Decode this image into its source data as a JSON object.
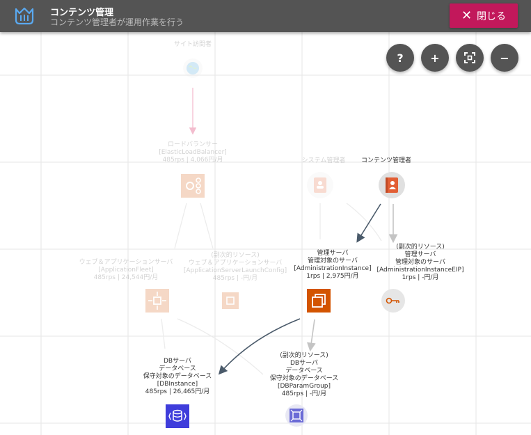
{
  "header": {
    "title": "コンテンツ管理",
    "subtitle": "コンテンツ管理者が運用作業を行う",
    "close_label": "閉じる",
    "logo_icon": "crown-basket-icon"
  },
  "controls": {
    "help": "?",
    "zoom_in": "+",
    "zoom_out": "−"
  },
  "colors": {
    "header_bg": "#545454",
    "close_button": "#c2185b",
    "admin_server": "#d35400",
    "db_server": "#3f3ddb",
    "content_admin": "#e25e34",
    "edge_dark": "#4a5a6a",
    "edge_light": "#c4c4c4"
  },
  "nodes": {
    "site_visitor": {
      "lines": [
        "サイト訪問者"
      ]
    },
    "load_balancer": {
      "lines": [
        "ロードバランサー",
        "[ElasticLoadBalancer]",
        "485rps | 4,066円/月"
      ]
    },
    "system_admin": {
      "lines": [
        "システム管理者"
      ]
    },
    "content_admin": {
      "lines": [
        "コンテンツ管理者"
      ]
    },
    "web_app_server": {
      "lines": [
        "ウェブ＆アプリケーションサーバ",
        "[ApplicationFleet]",
        "485rps | 24,544円/月"
      ]
    },
    "launch_config": {
      "lines": [
        "(副次的リソース)",
        "ウェブ＆アプリケーションサーバ",
        "[ApplicationServerLaunchConfig]",
        "485rps | -円/月"
      ]
    },
    "admin_server": {
      "lines": [
        "管理サーバ",
        "管理対象のサーバ",
        "[AdministrationInstance]",
        "1rps | 2,975円/月"
      ]
    },
    "admin_eip": {
      "lines": [
        "(副次的リソース)",
        "管理サーバ",
        "管理対象のサーバ",
        "[AdministrationInstanceEIP]",
        "1rps | -円/月"
      ]
    },
    "db_server": {
      "lines": [
        "DBサーバ",
        "データベース",
        "保守対象のデータベース",
        "[DBInstance]",
        "485rps | 26,465円/月"
      ]
    },
    "db_param": {
      "lines": [
        "(副次的リソース)",
        "DBサーバ",
        "データベース",
        "保守対象のデータベース",
        "[DBParamGroup]",
        "485rps | -円/月"
      ]
    }
  }
}
